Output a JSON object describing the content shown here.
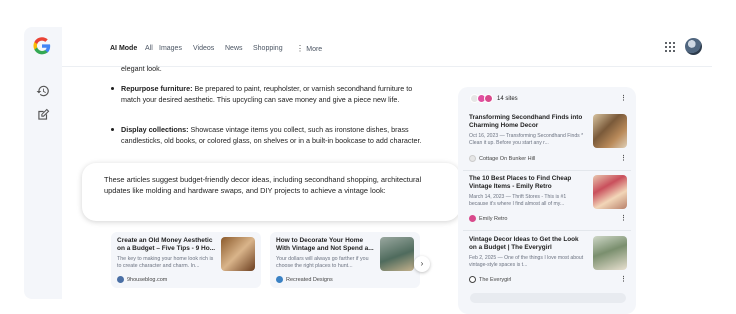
{
  "nav": {
    "tabs": [
      "AI Mode",
      "All",
      "Images",
      "Videos",
      "News",
      "Shopping"
    ],
    "more_label": "More"
  },
  "colors": {
    "accent_blue": "#1a73e8",
    "rail_bg": "#f4f6fa",
    "text": "#1f1f1f"
  },
  "main": {
    "fragment": "elegant look.",
    "bullets": [
      {
        "heading": "Repurpose furniture:",
        "text": " Be prepared to paint, reupholster, or varnish secondhand furniture to match your desired aesthetic. This upcycling can save money and give a piece new life."
      },
      {
        "heading": "Display collections:",
        "text": " Showcase vintage items you collect, such as ironstone dishes, brass candlesticks, old books, or colored glass, on shelves or in a built-in bookcase to add character."
      }
    ],
    "popover": "These articles suggest budget-friendly decor ideas, including secondhand shopping, architectural updates like molding and hardware swaps, and DIY projects to achieve a vintage look:"
  },
  "cards": [
    {
      "title": "Create an Old Money Aesthetic on a Budget – Five Tips - 9 Ho...",
      "snippet": "The key to making your home look rich is to create character and charm. In...",
      "source": "9houseblog.com"
    },
    {
      "title": "How to Decorate Your Home With Vintage and Not Spend a...",
      "snippet": "Your dollars will always go farther if you choose the right places to hunt...",
      "source": "Recreated Designs"
    }
  ],
  "panel": {
    "sites_label": "14 sites",
    "items": [
      {
        "title": "Transforming Secondhand Finds into Charming Home Decor",
        "snippet": "Oct 16, 2023 — Transforming Secondhand Finds * Clean it up. Before you start any r...",
        "source": "Cottage On Bunker Hill"
      },
      {
        "title": "The 10 Best Places to Find Cheap Vintage Items - Emily Retro",
        "snippet": "March 14, 2023 — Thrift Stores - This is #1 because it's where I find almost all of my...",
        "source": "Emily Retro"
      },
      {
        "title": "Vintage Decor Ideas to Get the Look on a Budget | The Everygirl",
        "snippet": "Feb 2, 2025 — One of the things I love most about vintage-style spaces is t...",
        "source": "The Everygirl"
      }
    ]
  },
  "icons": [
    "google-logo",
    "history-icon",
    "new-chat-icon",
    "apps-grid-icon",
    "avatar",
    "chevron-right-icon",
    "more-vert-icon"
  ]
}
